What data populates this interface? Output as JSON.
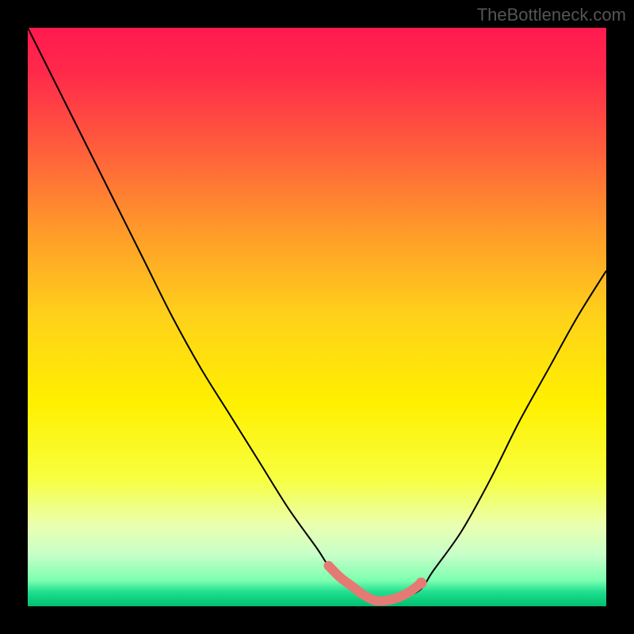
{
  "watermark": "TheBottleneck.com",
  "chart_data": {
    "type": "line",
    "title": "",
    "xlabel": "",
    "ylabel": "",
    "xlim": [
      0,
      100
    ],
    "ylim": [
      0,
      100
    ],
    "background_gradient": {
      "stops": [
        {
          "offset": 0.0,
          "color": "#ff1a4f"
        },
        {
          "offset": 0.08,
          "color": "#ff2a4a"
        },
        {
          "offset": 0.2,
          "color": "#ff5a3d"
        },
        {
          "offset": 0.35,
          "color": "#ff9a2a"
        },
        {
          "offset": 0.5,
          "color": "#ffd21a"
        },
        {
          "offset": 0.65,
          "color": "#fff000"
        },
        {
          "offset": 0.78,
          "color": "#f7ff40"
        },
        {
          "offset": 0.86,
          "color": "#eaffb0"
        },
        {
          "offset": 0.91,
          "color": "#c8ffc8"
        },
        {
          "offset": 0.955,
          "color": "#7dffb0"
        },
        {
          "offset": 0.975,
          "color": "#20e090"
        },
        {
          "offset": 1.0,
          "color": "#00c070"
        }
      ]
    },
    "series": [
      {
        "name": "bottleneck-curve",
        "color": "#000000",
        "width": 2,
        "x": [
          0,
          5,
          10,
          15,
          20,
          25,
          30,
          35,
          40,
          45,
          50,
          52,
          55,
          58,
          60,
          62,
          65,
          68,
          70,
          75,
          80,
          85,
          90,
          95,
          100
        ],
        "y": [
          100,
          90,
          80,
          70,
          60,
          50,
          41,
          33,
          25,
          17,
          10,
          7,
          4,
          2,
          1,
          1,
          1.5,
          3,
          6,
          13,
          22,
          32,
          41,
          50,
          58
        ]
      }
    ],
    "highlight": {
      "name": "optimal-range",
      "color": "#e57a74",
      "width": 12,
      "x": [
        52,
        54,
        56,
        58,
        60,
        62,
        64,
        66,
        68
      ],
      "y": [
        7,
        5,
        3.5,
        2,
        1,
        1,
        1.5,
        2.5,
        4
      ],
      "points_r": [
        6,
        0,
        0,
        0,
        0,
        0,
        0,
        0,
        7
      ]
    }
  }
}
